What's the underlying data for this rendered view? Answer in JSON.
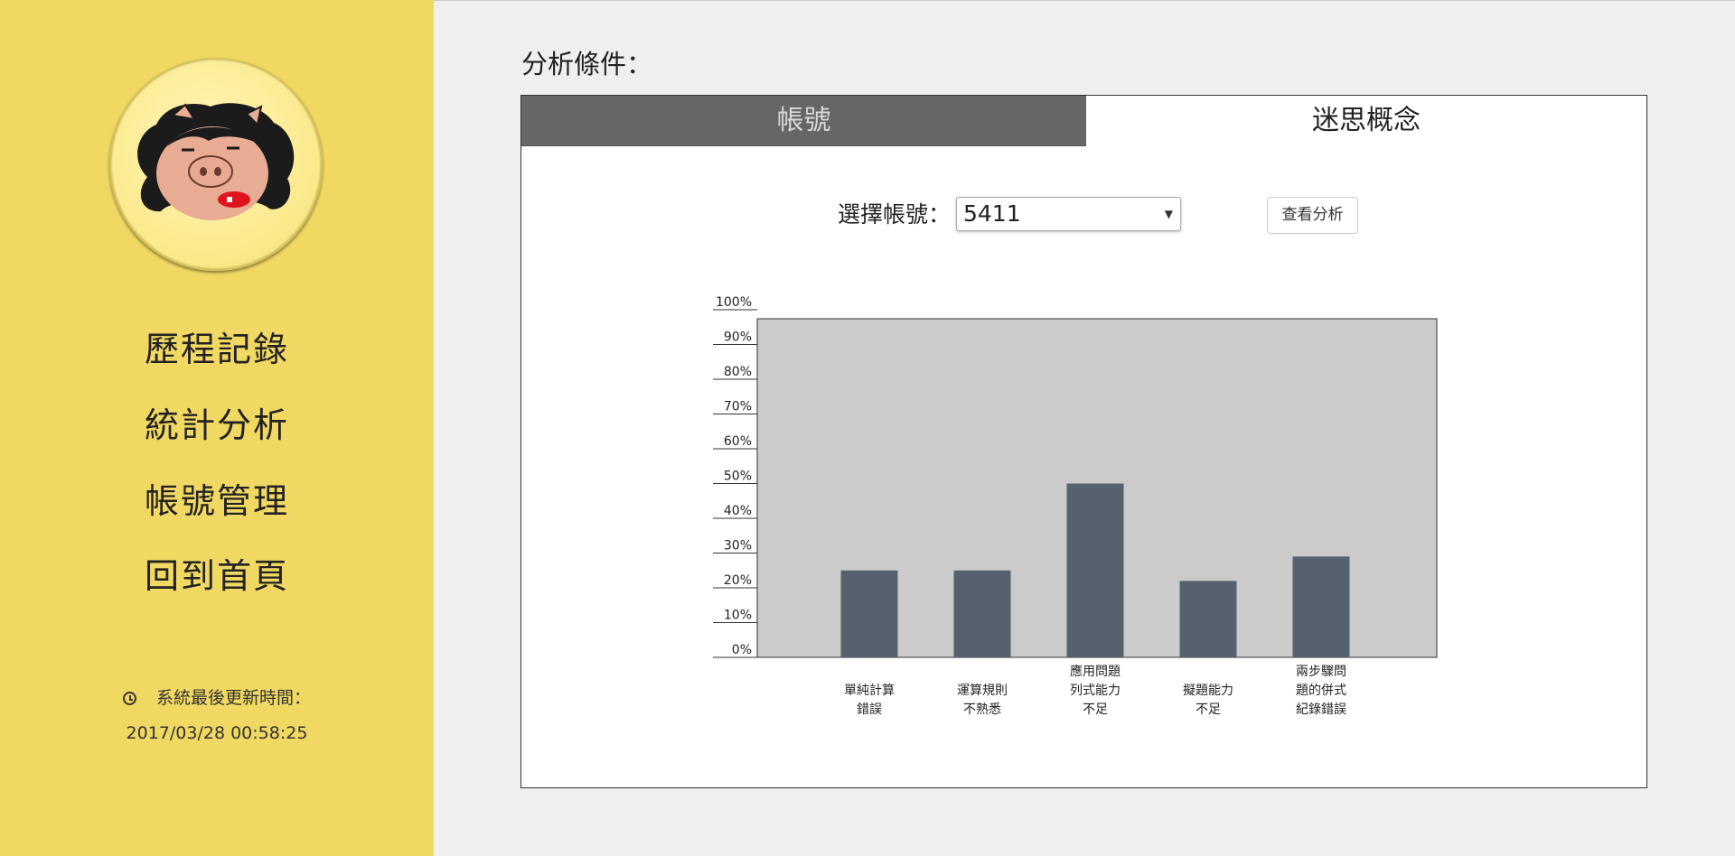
{
  "sidebar": {
    "nav": [
      {
        "label": "歷程記錄"
      },
      {
        "label": "統計分析"
      },
      {
        "label": "帳號管理"
      },
      {
        "label": "回到首頁"
      }
    ],
    "update_label": "系統最後更新時間：",
    "update_time": "2017/03/28 00:58:25"
  },
  "main": {
    "title": "分析條件：",
    "tabs": [
      {
        "label": "帳號",
        "active": false
      },
      {
        "label": "迷思概念",
        "active": true
      }
    ],
    "select_label": "選擇帳號：",
    "select_value": "5411",
    "view_button": "查看分析"
  },
  "colors": {
    "sidebar_bg": "#f0d862",
    "bar": "#56616e",
    "plot_bg": "#cbcbcb",
    "inactive_tab": "#666666"
  },
  "chart_data": {
    "type": "bar",
    "categories": [
      [
        "單純計算",
        "錯誤"
      ],
      [
        "運算規則",
        "不熟悉"
      ],
      [
        "應用問題",
        "列式能力",
        "不足"
      ],
      [
        "擬題能力",
        "不足"
      ],
      [
        "兩步驟問",
        "題的併式",
        "紀錄錯誤"
      ]
    ],
    "values": [
      25,
      25,
      50,
      22,
      29
    ],
    "ylim": [
      0,
      100
    ],
    "yticks": [
      "0%",
      "10%",
      "20%",
      "30%",
      "40%",
      "50%",
      "60%",
      "70%",
      "80%",
      "90%",
      "100%"
    ],
    "grid": false
  }
}
